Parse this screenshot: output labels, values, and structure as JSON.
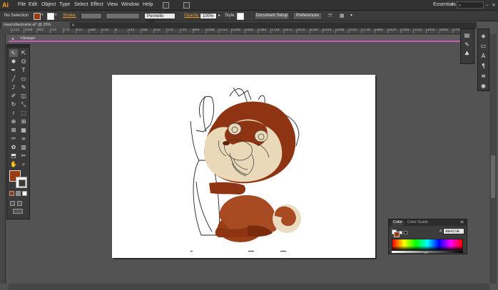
{
  "app": {
    "logo": "Ai"
  },
  "menu": [
    "File",
    "Edit",
    "Object",
    "Type",
    "Select",
    "Effect",
    "View",
    "Window",
    "Help"
  ],
  "workspace": {
    "label": "Essentials"
  },
  "control_bar": {
    "selection_label": "No Selection",
    "stroke_label": "Stroke:",
    "brush_value": "Pennello calli...",
    "opacity_label": "Opacity:",
    "opacity_value": "100%",
    "style_label": "Style:",
    "document_setup": "Document Setup",
    "preferences": "Preferences",
    "fill_color": "#9b3c13"
  },
  "document": {
    "tab_title": "mascottacinarte.ai* @ 25% (RGB/Preview)",
    "isolation_label": "<Group>"
  },
  "ruler_ticks": [
    "1152",
    "1008",
    "864",
    "720",
    "576",
    "432",
    "288",
    "144",
    "0",
    "144",
    "288",
    "432",
    "576",
    "720",
    "864",
    "1008",
    "1152",
    "1296",
    "1440",
    "1584",
    "1728",
    "1872",
    "2016",
    "2160",
    "2304",
    "2448",
    "2592",
    "2736",
    "2880",
    "3024",
    "3168",
    "3312",
    "3456",
    "3600",
    "3744",
    "3888"
  ],
  "tools": [
    "selection-tool",
    "direct-selection-tool",
    "magic-wand-tool",
    "lasso-tool",
    "pen-tool",
    "type-tool",
    "line-tool",
    "rectangle-tool",
    "paintbrush-tool",
    "pencil-tool",
    "blob-brush-tool",
    "eraser-tool",
    "rotate-tool",
    "scale-tool",
    "width-tool",
    "free-transform-tool",
    "shape-builder-tool",
    "perspective-grid-tool",
    "mesh-tool",
    "gradient-tool",
    "eyedropper-tool",
    "blend-tool",
    "symbol-sprayer-tool",
    "column-graph-tool",
    "artboard-tool",
    "slice-tool",
    "hand-tool",
    "zoom-tool"
  ],
  "color_panel": {
    "tab_active": "Color",
    "tab_inactive": "Color Guide",
    "hash": "#",
    "hex_value": "9B421B",
    "fill_color": "#9b3c13"
  },
  "colors": {
    "mascot_brown": "#8f3412",
    "mascot_mid": "#a84a22",
    "mascot_cream": "#ead9b8",
    "isolation_accent": "#c35fb6"
  }
}
